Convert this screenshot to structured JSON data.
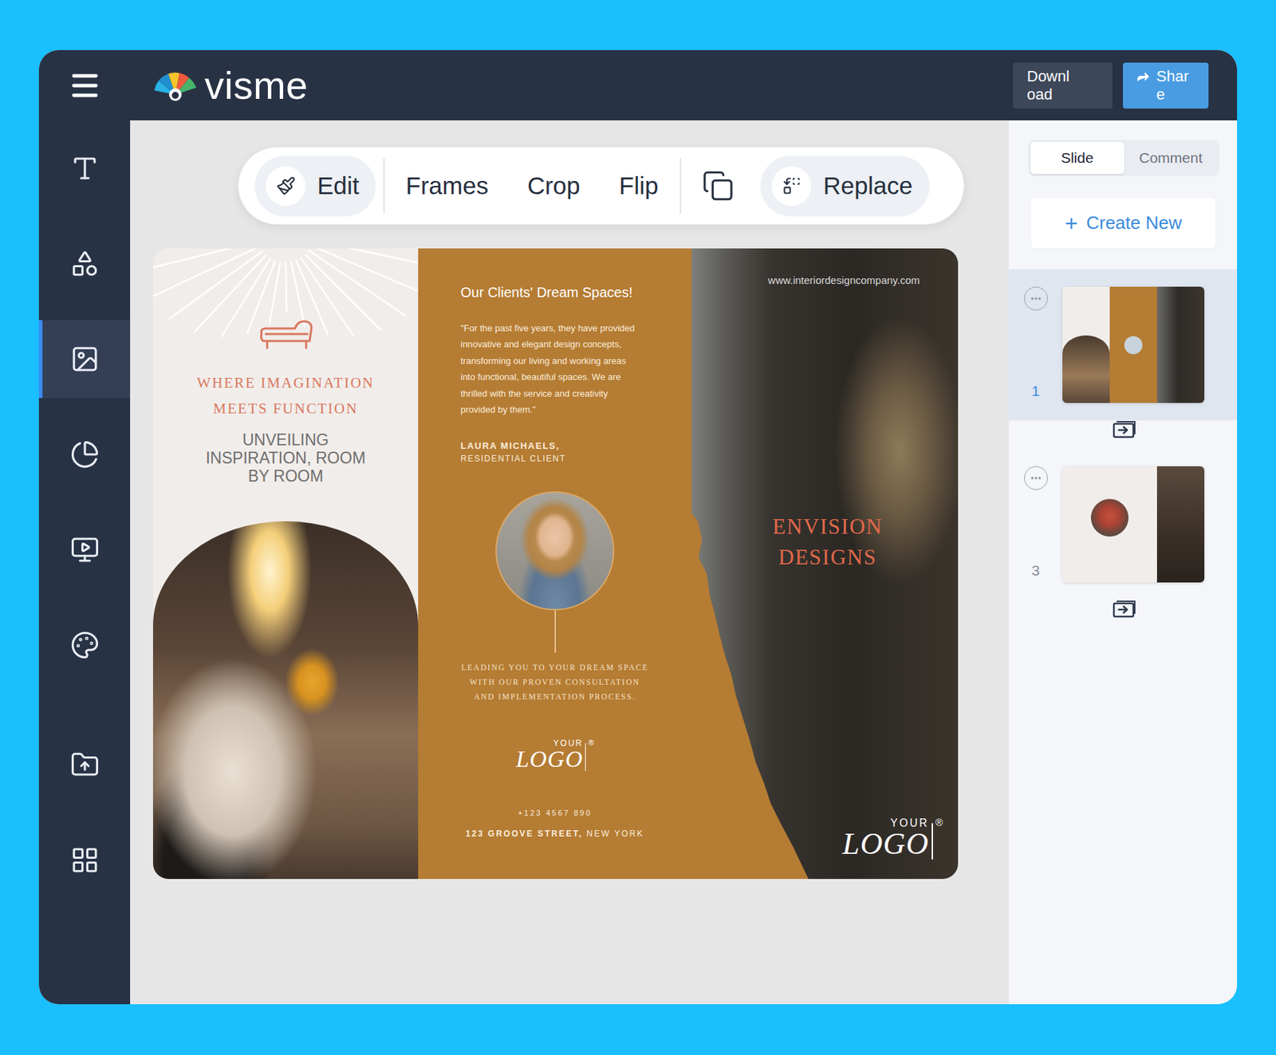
{
  "app": {
    "logo": "visme"
  },
  "header": {
    "buttons": [
      {
        "label": "Download",
        "kind": "secondary"
      },
      {
        "label": "Share",
        "kind": "primary"
      }
    ]
  },
  "sidebar": {
    "items": [
      {
        "selected": false
      },
      {
        "selected": false
      },
      {
        "selected": true
      },
      {
        "selected": false
      },
      {
        "selected": false
      },
      {
        "selected": false
      },
      {
        "selected": false
      },
      {
        "selected": false
      }
    ]
  },
  "toolbar": {
    "edit": "Edit",
    "actions": [
      "Frames",
      "Crop",
      "Flip"
    ],
    "replace": "Replace"
  },
  "brochure": {
    "left": {
      "headline": [
        "WHERE IMAGINATION",
        "MEETS FUNCTION"
      ],
      "tagline": [
        "UNVEILING",
        "INSPIRATION, ROOM",
        "BY ROOM"
      ]
    },
    "middle": {
      "title": "Our Clients' Dream Spaces!",
      "quote": [
        "\"For the past five years, they have provided",
        "innovative and elegant design concepts,",
        "transforming our living and working areas",
        "into functional, beautiful spaces. We are",
        "thrilled with the service and creativity",
        "provided by them.\""
      ],
      "author": "LAURA MICHAELS,",
      "role": "RESIDENTIAL CLIENT",
      "promise": [
        "LEADING YOU TO YOUR DREAM SPACE",
        "WITH OUR PROVEN CONSULTATION",
        "AND IMPLEMENTATION PROCESS."
      ],
      "logo": {
        "top": "YOUR",
        "main": "LOGO",
        "mark": "®"
      },
      "phone": "+123 4567 890",
      "address": [
        {
          "text": "123 GROOVE STREET,",
          "bold": true
        },
        {
          "text": "NEW YORK",
          "bold": false
        }
      ]
    },
    "right": {
      "url": "www.interiordesigncompany.com",
      "title": [
        "ENVISION",
        "DESIGNS"
      ],
      "logo": {
        "top": "YOUR",
        "main": "LOGO",
        "mark": "®"
      }
    }
  },
  "right_panel": {
    "tabs": [
      {
        "label": "Slide",
        "selected": true
      },
      {
        "label": "Comment",
        "selected": false
      }
    ],
    "create_button": {
      "icon": "+",
      "label": "Create New"
    },
    "slides": [
      {
        "number": "1",
        "selected": true,
        "kind": "inside"
      },
      {
        "number": "3",
        "selected": false,
        "kind": "outside"
      }
    ]
  }
}
